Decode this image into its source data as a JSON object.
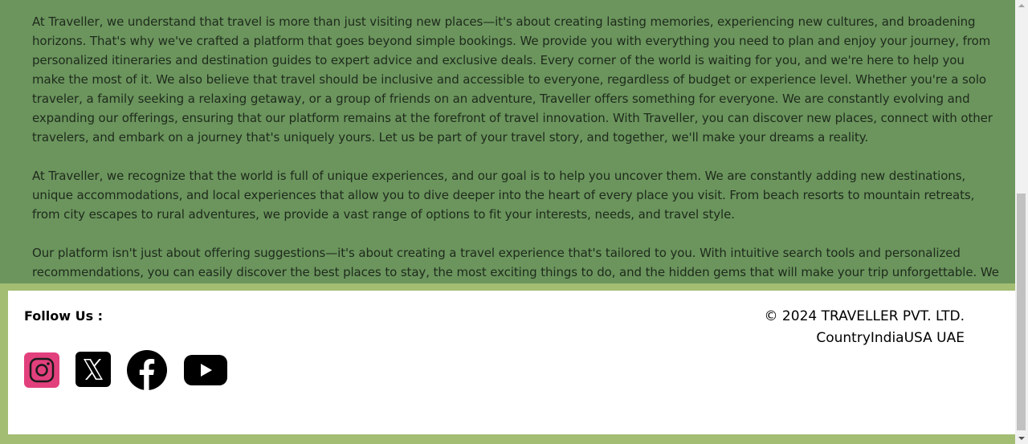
{
  "about": {
    "paragraphs": [
      "At Traveller, we understand that travel is more than just visiting new places—it's about creating lasting memories, experiencing new cultures, and broadening horizons. That's why we've crafted a platform that goes beyond simple bookings. We provide you with everything you need to plan and enjoy your journey, from personalized itineraries and destination guides to expert advice and exclusive deals. Every corner of the world is waiting for you, and we're here to help you make the most of it. We also believe that travel should be inclusive and accessible to everyone, regardless of budget or experience level. Whether you're a solo traveler, a family seeking a relaxing getaway, or a group of friends on an adventure, Traveller offers something for everyone. We are constantly evolving and expanding our offerings, ensuring that our platform remains at the forefront of travel innovation. With Traveller, you can discover new places, connect with other travelers, and embark on a journey that's uniquely yours. Let us be part of your travel story, and together, we'll make your dreams a reality.",
      "At Traveller, we recognize that the world is full of unique experiences, and our goal is to help you uncover them. We are constantly adding new destinations, unique accommodations, and local experiences that allow you to dive deeper into the heart of every place you visit. From beach resorts to mountain retreats, from city escapes to rural adventures, we provide a vast range of options to fit your interests, needs, and travel style.",
      "Our platform isn't just about offering suggestions—it's about creating a travel experience that's tailored to you. With intuitive search tools and personalized recommendations, you can easily discover the best places to stay, the most exciting things to do, and the hidden gems that will make your trip unforgettable. We"
    ]
  },
  "footer": {
    "follow_label": "Follow Us :",
    "copyright": "© 2024 TRAVELLER PVT. LTD.",
    "countries": "CountryIndiaUSA UAE",
    "social_icons": [
      "instagram-icon",
      "x-twitter-icon",
      "facebook-icon",
      "youtube-icon"
    ]
  },
  "colors": {
    "content_bg": "#6b955d",
    "page_bg": "#a3bd73",
    "footer_bg": "#ffffff",
    "instagram": "#e1306c"
  }
}
